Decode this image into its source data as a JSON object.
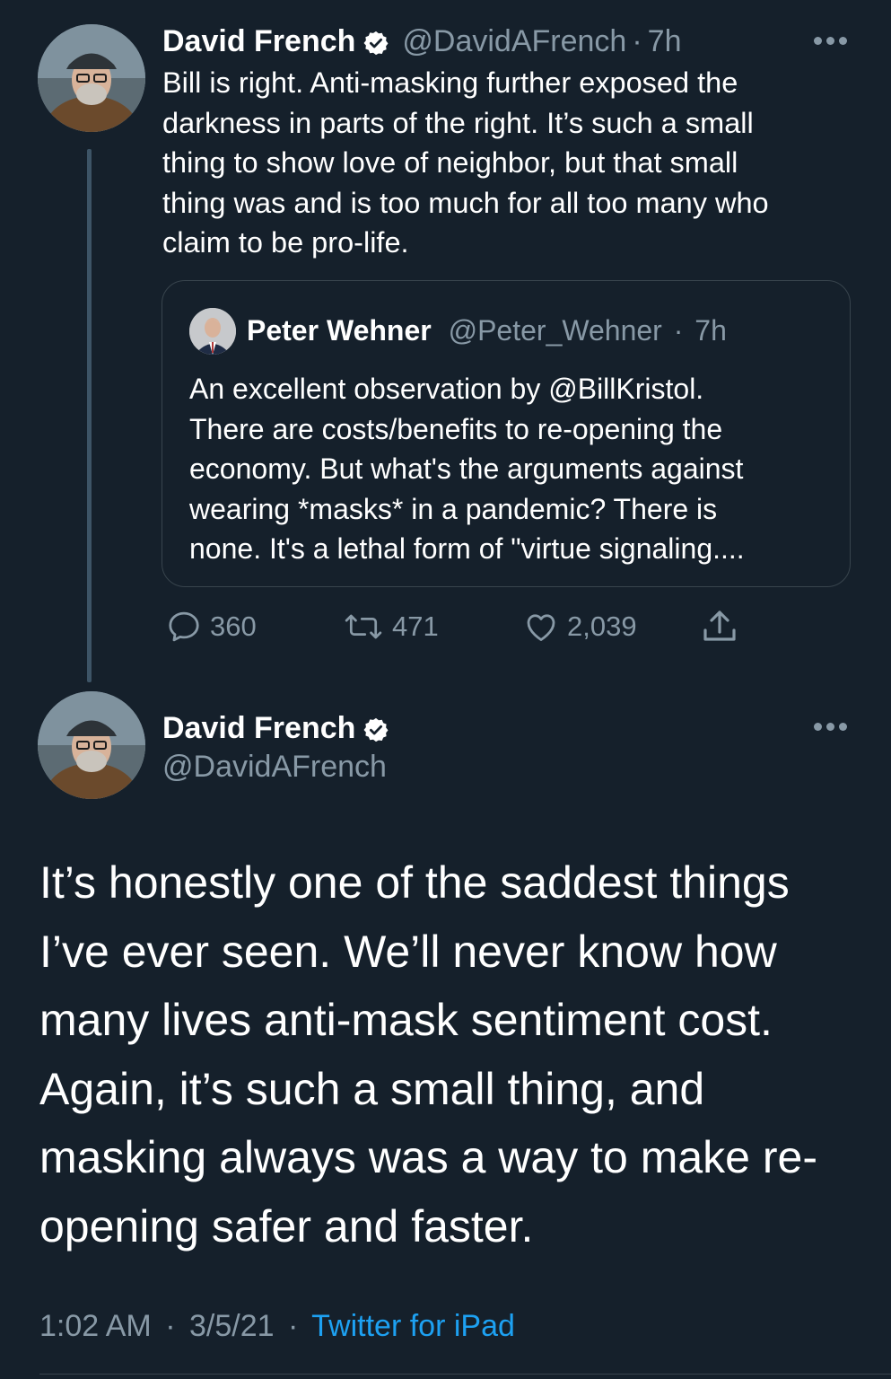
{
  "reply_tweet": {
    "author": {
      "display_name": "David French",
      "handle": "@DavidAFrench",
      "verified": true
    },
    "separator": "·",
    "time_ago": "7h",
    "text": "Bill is right. Anti-masking further exposed the\ndarkness in parts of the right. It’s such a small\nthing to show love of neighbor, but that small\nthing was and is too much for all too many who\nclaim to be pro-life.",
    "quoted_tweet": {
      "author": {
        "display_name": "Peter Wehner",
        "handle": "@Peter_Wehner"
      },
      "separator": "·",
      "time_ago": "7h",
      "text": "An excellent observation by @BillKristol.\nThere are costs/benefits to re-opening the\neconomy. But what's the arguments against\nwearing *masks* in a pandemic? There is\nnone. It's a lethal form of \"virtue signaling...."
    },
    "actions": {
      "replies": "360",
      "retweets": "471",
      "likes": "2,039"
    },
    "icons": {
      "reply": "reply-icon",
      "retweet": "retweet-icon",
      "like": "heart-icon",
      "share": "share-icon",
      "more": "more-icon",
      "verified": "verified-badge-icon"
    }
  },
  "focused_tweet": {
    "author": {
      "display_name": "David French",
      "handle": "@DavidAFrench",
      "verified": true
    },
    "text": "It’s honestly one of the saddest things\nI’ve ever seen. We’ll never know how\nmany lives anti-mask sentiment cost.\nAgain, it’s such a small thing, and\nmasking always was a way to make re-\nopening safer and faster.",
    "time": "1:02 AM",
    "separator": "·",
    "date": "3/5/21",
    "source": "Twitter for iPad"
  },
  "colors": {
    "background": "#15202b",
    "text_primary": "#ffffff",
    "text_secondary": "#8899a6",
    "link": "#1da1f2",
    "border": "#38444d",
    "thread_line": "#3d5466"
  }
}
